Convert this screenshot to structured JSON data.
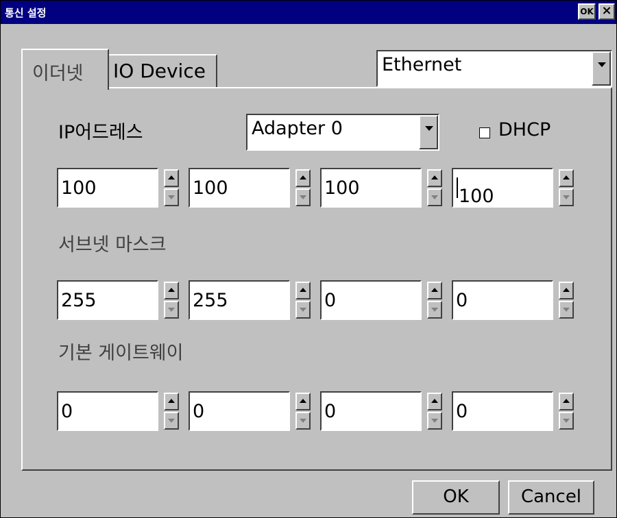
{
  "window": {
    "title": "통신 설정",
    "ok_button": "OK",
    "close_icon": "×"
  },
  "tabs": [
    {
      "label": "이더넷",
      "active": true
    },
    {
      "label": "IO Device",
      "active": false
    }
  ],
  "connection_type": {
    "value": "Ethernet"
  },
  "ip_section": {
    "label": "IP어드레스",
    "adapter": {
      "value": "Adapter 0"
    },
    "dhcp": {
      "label": "DHCP",
      "checked": false
    },
    "octets": [
      "100",
      "100",
      "100",
      "100"
    ]
  },
  "subnet_section": {
    "label": "서브넷 마스크",
    "octets": [
      "255",
      "255",
      "0",
      "0"
    ]
  },
  "gateway_section": {
    "label": "기본 게이트웨이",
    "octets": [
      "0",
      "0",
      "0",
      "0"
    ]
  },
  "buttons": {
    "ok": "OK",
    "cancel": "Cancel"
  }
}
